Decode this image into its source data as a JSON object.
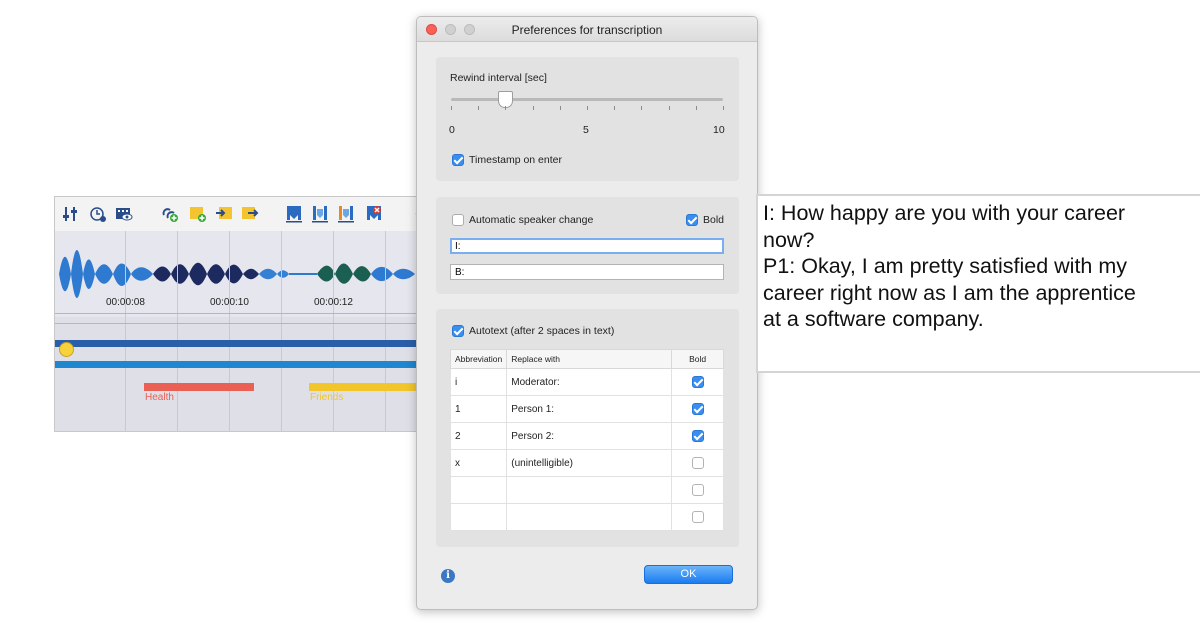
{
  "media_panel": {
    "toolbar_icons": [
      "mixer-icon",
      "clock-settings-icon",
      "video-icon",
      "add-audio-link-icon",
      "add-memo-icon",
      "import-icon",
      "export-icon",
      "bookmark-icon",
      "bookmark-down-icon",
      "bookmark-color-icon",
      "bookmark-delete-icon"
    ],
    "time_labels": [
      "00:00:08",
      "00:00:10",
      "00:00:12"
    ],
    "codes": [
      {
        "label": "Health",
        "color": "#ea6054"
      },
      {
        "label": "Friends",
        "color": "#f2c52a"
      }
    ],
    "track_colors": {
      "dark": "#2a5ea8",
      "light": "#1f86d0"
    }
  },
  "dialog": {
    "title": "Preferences for transcription",
    "rewind": {
      "label": "Rewind interval [sec]",
      "min_label": "0",
      "mid_label": "5",
      "max_label": "10",
      "value": 2,
      "min": 0,
      "max": 10
    },
    "timestamp_on_enter": {
      "label": "Timestamp on enter",
      "checked": true
    },
    "speaker": {
      "auto_change_label": "Automatic speaker change",
      "auto_change_checked": false,
      "bold_label": "Bold",
      "bold_checked": true,
      "speaker1_value": "I:",
      "speaker2_value": "B:"
    },
    "autotext": {
      "label": "Autotext (after 2 spaces in text)",
      "checked": true,
      "columns": [
        "Abbreviation",
        "Replace with",
        "Bold"
      ],
      "rows": [
        {
          "abbr": "i",
          "replace": "Moderator:",
          "bold": true
        },
        {
          "abbr": "1",
          "replace": "Person 1:",
          "bold": true
        },
        {
          "abbr": "2",
          "replace": "Person 2:",
          "bold": true
        },
        {
          "abbr": "x",
          "replace": "(unintelligible)",
          "bold": false
        },
        {
          "abbr": "",
          "replace": "",
          "bold": false
        },
        {
          "abbr": "",
          "replace": "",
          "bold": false
        }
      ]
    },
    "info_glyph": "i",
    "ok_label": "OK",
    "accent_color": "#3a8ef1"
  },
  "transcript": {
    "lines": [
      "I: How happy are you with your career",
      "now?",
      "P1: Okay, I am pretty satisfied with my",
      "career right now as I am the apprentice",
      "at a software company."
    ]
  }
}
